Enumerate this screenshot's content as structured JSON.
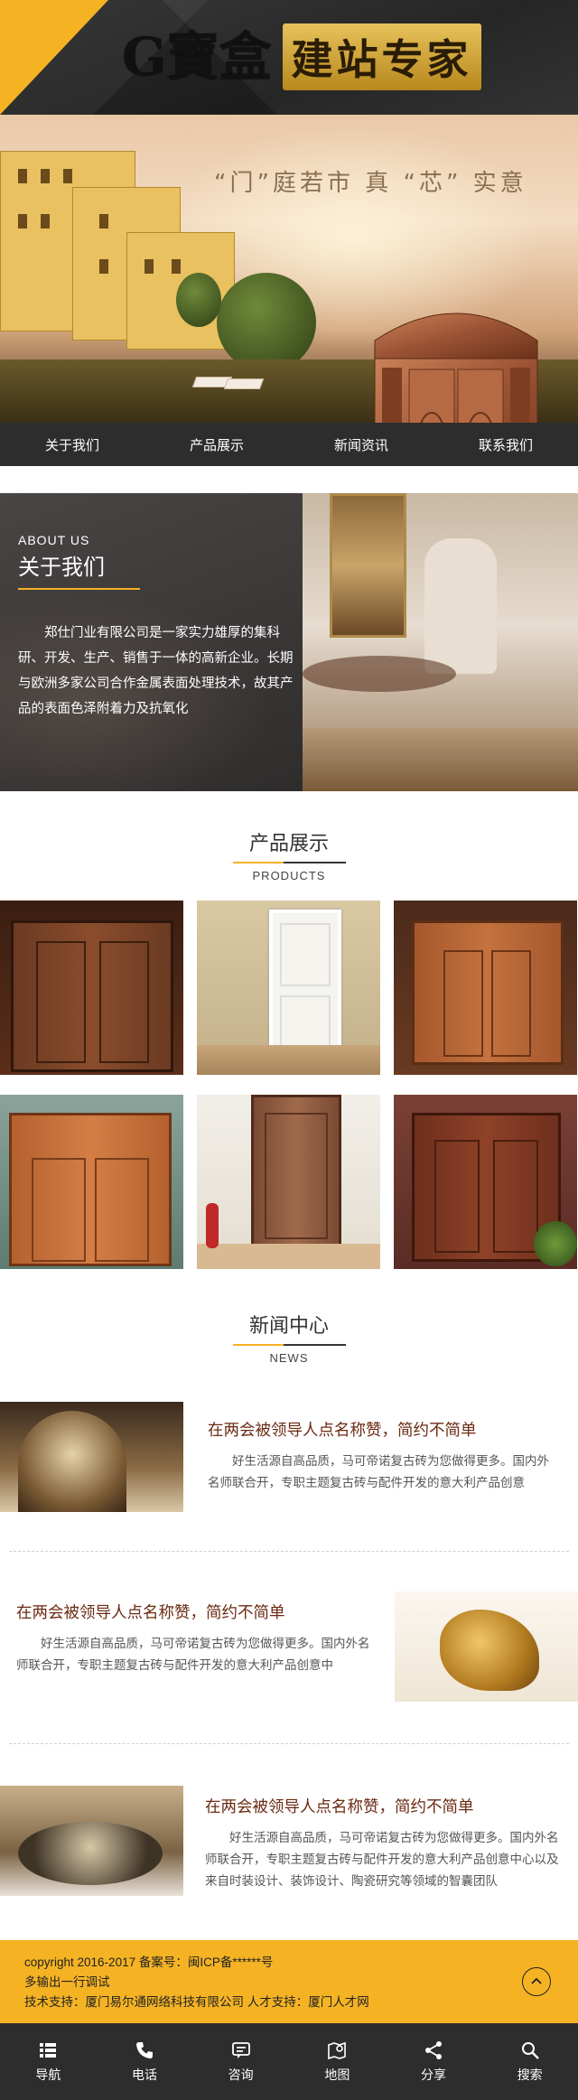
{
  "header": {
    "logo_mark": "G寶盒",
    "slogan": "建站专家"
  },
  "banner": {
    "text": "“门”庭若市 真 “芯” 实意"
  },
  "nav": {
    "items": [
      "关于我们",
      "产品展示",
      "新闻资讯",
      "联系我们"
    ]
  },
  "about": {
    "en": "ABOUT US",
    "cn": "关于我们",
    "text": "郑仕门业有限公司是一家实力雄厚的集科研、开发、生产、销售于一体的高新企业。长期与欧洲多家公司合作金属表面处理技术，故其产品的表面色泽附着力及抗氧化"
  },
  "products": {
    "title_cn": "产品展示",
    "title_en": "PRODUCTS"
  },
  "news": {
    "title_cn": "新闻中心",
    "title_en": "NEWS",
    "items": [
      {
        "title": "在两会被领导人点名称赞，简约不简单",
        "desc": "好生活源自高品质，马可帝诺复古砖为您做得更多。国内外名师联合开，专职主题复古砖与配件开发的意大利产品创意"
      },
      {
        "title": "在两会被领导人点名称赞，简约不简单",
        "desc": "好生活源自高品质，马可帝诺复古砖为您做得更多。国内外名师联合开，专职主题复古砖与配件开发的意大利产品创意中"
      },
      {
        "title": "在两会被领导人点名称赞，简约不简单",
        "desc": "好生活源自高品质，马可帝诺复古砖为您做得更多。国内外名师联合开，专职主题复古砖与配件开发的意大利产品创意中心以及来自时装设计、装饰设计、陶瓷研究等领域的智囊团队"
      }
    ]
  },
  "footer": {
    "line1": "copyright 2016-2017 备案号：闽ICP备******号",
    "line2": "多输出一行调试",
    "line3": "技术支持：厦门易尔通网络科技有限公司 人才支持：厦门人才网",
    "top_icon": "chevron-up-icon"
  },
  "bottom_bar": {
    "items": [
      {
        "label": "导航",
        "icon": "menu-icon"
      },
      {
        "label": "电话",
        "icon": "phone-icon"
      },
      {
        "label": "咨询",
        "icon": "chat-icon"
      },
      {
        "label": "地图",
        "icon": "map-icon"
      },
      {
        "label": "分享",
        "icon": "share-icon"
      },
      {
        "label": "搜索",
        "icon": "search-icon"
      }
    ]
  },
  "colors": {
    "accent": "#f5b324",
    "dark": "#2d2d2d",
    "news_title": "#6b2a12"
  }
}
